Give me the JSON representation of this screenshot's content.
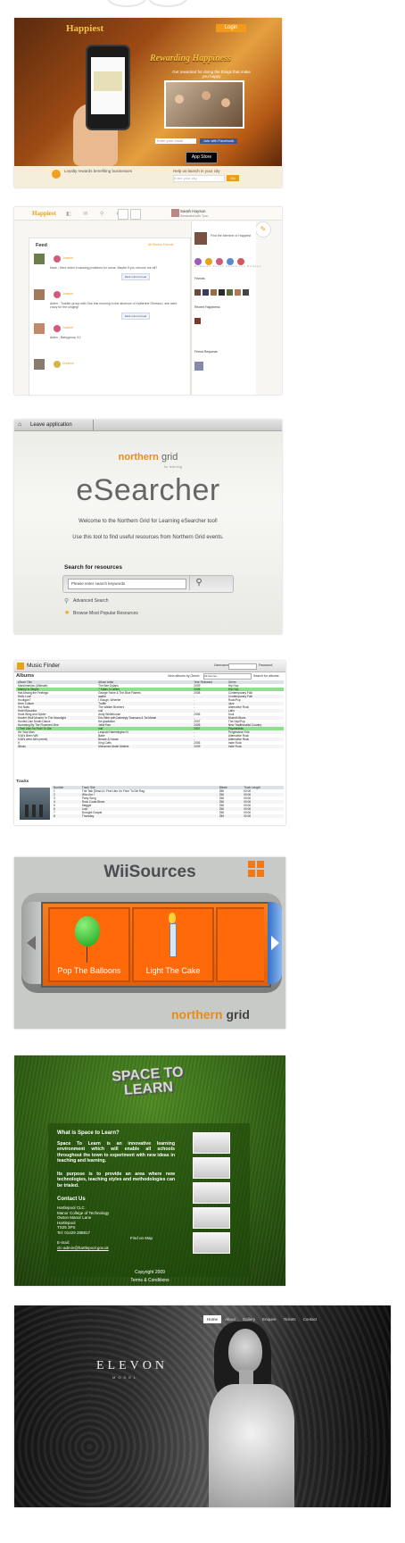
{
  "happiest_landing": {
    "logo": "Happiest",
    "login_button": "Login",
    "tagline": "Rewarding Happiness",
    "subtitle": "Get rewarded for doing the things that make you happy",
    "email_placeholder": "Enter your email",
    "facebook_button": "Join with Facebook",
    "app_store": "App Store",
    "footer_left": "Loyalty rewards benefiting businesses",
    "footer_right": "Help us launch in your city",
    "city_placeholder": "Enter your city",
    "go_button": "Go"
  },
  "happiest_feed": {
    "logo": "Happiest",
    "user_name": "Sarah Hayson",
    "user_sub": "Rewarded with Tycn",
    "feed_title": "Feed",
    "feed_tabs": "All Stories   Friends",
    "items": [
      {
        "name": "Joachel",
        "text": "Mark - Here when it causing problems for some. Maybe if you remove me all?",
        "button": "Mark current head"
      },
      {
        "name": "Joachel",
        "text": "Aiden - Toddler group with Sue this morning in the absence of Katherine Ohnsson, she went crazy for the singing!",
        "button": "Mark current head"
      },
      {
        "name": "Joachel",
        "text": "Aiden - Babygroup 3:1",
        "button": ""
      },
      {
        "name": "Donkins",
        "text": "",
        "button": ""
      }
    ],
    "side_intro": "Find the Member of Happiest",
    "stats_labels": "Rewards  Posts  Check-ins  Badges",
    "friends_title": "Friends",
    "recent_title": "Recent Happiness",
    "friend_requests": "Friend Requests"
  },
  "esearcher": {
    "leave": "Leave application",
    "brand_northern": "northern",
    "brand_grid": "grid",
    "for_learning": "for learning",
    "title": "eSearcher",
    "welcome": "Welcome to the Northern Grid for Learning eSearcher tool!",
    "use_text": "Use this tool to find useful resources from Northern Grid events.",
    "search_heading": "Search for resources",
    "search_placeholder": "Please enter search keywords",
    "advanced": "Advanced Search",
    "popular": "Browse Most Popular Resources"
  },
  "music_finder": {
    "title": "Music Finder",
    "username_label": "Username",
    "password_label": "Password",
    "albums_heading": "Albums",
    "genre_label": "View albums by Genre:",
    "genre_value": "All Genres",
    "search_albums": "Search for albums:",
    "album_columns": [
      "Album Title",
      "Album Artist",
      "Year Released",
      "Genre"
    ],
    "albums": [
      [
        "Marshmellow (Ultimate)",
        "The Bee Dylans",
        "2009",
        "Hip Hop"
      ],
      [
        "Marley Is Simple",
        "7 Kates 3 Lathes",
        "2006",
        "Hip Hop"
      ],
      [
        "Hat Among the Feelings",
        "George Fame & The Blue Flames",
        "2008",
        "Contemporary Folk"
      ],
      [
        "Hello Love",
        "aaalla",
        "-",
        "Contemporary Folk"
      ],
      [
        "Hooligan?",
        "I Slough, Wheeler",
        "-",
        "Rock/Pop"
      ],
      [
        "Here Culture",
        "Truffle",
        "-",
        "Jazz"
      ],
      [
        "Hot Nails",
        "The Walker Brothers",
        "-",
        "Alternative Rock"
      ],
      [
        "Hotel Bosunba",
        "null",
        "-",
        "Latin"
      ],
      [
        "Howl-Wing and Spider",
        "Andy Whitehouse",
        "2006",
        "Soul"
      ],
      [
        "Howlin' Wolf Moanin' In The Moonlight",
        "Eric Bibb with Dalmeyty Taunsara & Tai Mahal",
        "-",
        "Bluesth Blues"
      ],
      [
        "Hunted Like Death Dance",
        "the gladiation",
        "2007",
        "The Hop/Pop"
      ],
      [
        "Humming By The Flowered Vine",
        "Jellie Rae",
        "2005",
        "New Traditionalist Country"
      ],
      [
        "I Feel Like I'm Fixin' To Die",
        "null",
        "2007",
        "Psychedelic"
      ],
      [
        "I'm Your Man",
        "Leopold Hammington IV",
        "-",
        "Progressive Folk"
      ],
      [
        "If All's Been Will",
        "Babe",
        "-",
        "Alternative Rock"
      ],
      [
        "If All's were All's (remix)",
        "Bessie & House",
        "-",
        "Alternative Rock"
      ],
      [
        "II",
        "King Coffs",
        "2006",
        "Indie Rock"
      ],
      [
        "Illinois",
        "Mohamed Abdel Mottels",
        "2009",
        "Indie Rock"
      ]
    ],
    "tracks_heading": "Tracks",
    "track_columns": [
      "Number",
      "Track Title",
      "Bitrate",
      "Track Length"
    ],
    "tracks": [
      [
        "1",
        "The Talk (Dead & I Feel Like I'm Fixin' To Die Rag",
        "256",
        "00:00"
      ],
      [
        "2",
        "Who Am I",
        "256",
        "00:00"
      ],
      [
        "3",
        "Party Song",
        "256",
        "00:00"
      ],
      [
        "4",
        "Rock Coast Blues",
        "256",
        "00:00"
      ],
      [
        "5",
        "Maggie",
        "256",
        "00:00"
      ],
      [
        "6",
        "Lust",
        "256",
        "00:00"
      ],
      [
        "7",
        "Drought Gospel",
        "256",
        "00:00"
      ],
      [
        "8",
        "Thursday",
        "256",
        "00:00"
      ]
    ]
  },
  "wiisources": {
    "title": "WiiSources",
    "cards": [
      "Pop The Balloons",
      "Light The Cake"
    ],
    "brand_northern": "northern",
    "brand_grid": "grid"
  },
  "space_to_learn": {
    "logo": "SPACE TO LEARN",
    "q_heading": "What is Space to Learn?",
    "p1": "Space To Learn is an innovative learning environment which will enable all schools throughout the town to experiment with new ideas in teaching and learning.",
    "p2": "Its purpose is to provide an area where new technologies, teaching styles and methodologies can be trialed.",
    "contact_heading": "Contact Us",
    "address": [
      "Hartlepool CLC",
      "Manor College of Technology",
      "Owton Manor Lane",
      "Hartlepool",
      "TS25 3PS",
      "Tel: 01429 288817"
    ],
    "email_label": "E-mail:",
    "email": "clc-admin@hartlepool.gov.uk",
    "find_map": "Find on Map",
    "copyright": "Copyright 2009",
    "terms": "Terms & Conditions"
  },
  "elevon": {
    "nav": [
      "Home",
      "About",
      "Gallery",
      "Enquire",
      "Tickets",
      "Contact"
    ],
    "brand": "ELEVON",
    "brand_sub": "MODEL"
  }
}
